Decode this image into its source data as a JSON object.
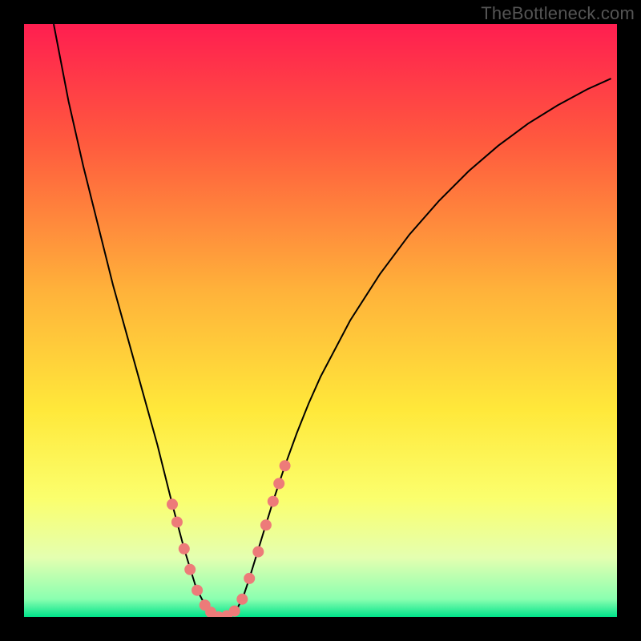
{
  "watermark": "TheBottleneck.com",
  "chart_data": {
    "type": "line",
    "title": "",
    "xlabel": "",
    "ylabel": "",
    "xlim": [
      0,
      1
    ],
    "ylim": [
      0,
      1
    ],
    "background_gradient": {
      "stops": [
        {
          "offset": 0.0,
          "color": "#ff1e50"
        },
        {
          "offset": 0.2,
          "color": "#ff5a3e"
        },
        {
          "offset": 0.45,
          "color": "#ffb23a"
        },
        {
          "offset": 0.65,
          "color": "#ffe83a"
        },
        {
          "offset": 0.8,
          "color": "#fbff6d"
        },
        {
          "offset": 0.9,
          "color": "#e4ffb0"
        },
        {
          "offset": 0.97,
          "color": "#8affb0"
        },
        {
          "offset": 1.0,
          "color": "#00e38a"
        }
      ]
    },
    "series": [
      {
        "name": "curve",
        "stroke": "#000000",
        "x": [
          0.05,
          0.075,
          0.1,
          0.125,
          0.15,
          0.175,
          0.2,
          0.225,
          0.25,
          0.27,
          0.29,
          0.3,
          0.31,
          0.32,
          0.33,
          0.34,
          0.35,
          0.36,
          0.37,
          0.38,
          0.4,
          0.42,
          0.44,
          0.46,
          0.48,
          0.5,
          0.55,
          0.6,
          0.65,
          0.7,
          0.75,
          0.8,
          0.85,
          0.9,
          0.95,
          0.99
        ],
        "y": [
          1.0,
          0.87,
          0.76,
          0.66,
          0.56,
          0.47,
          0.38,
          0.29,
          0.19,
          0.115,
          0.05,
          0.03,
          0.015,
          0.005,
          0.0,
          0.0,
          0.005,
          0.015,
          0.035,
          0.065,
          0.13,
          0.195,
          0.255,
          0.31,
          0.36,
          0.405,
          0.5,
          0.578,
          0.645,
          0.702,
          0.752,
          0.795,
          0.832,
          0.863,
          0.89,
          0.908
        ]
      }
    ],
    "markers": {
      "color": "#ed7b79",
      "radius_px": 7,
      "points": [
        {
          "x": 0.25,
          "y": 0.19
        },
        {
          "x": 0.258,
          "y": 0.16
        },
        {
          "x": 0.27,
          "y": 0.115
        },
        {
          "x": 0.28,
          "y": 0.08
        },
        {
          "x": 0.292,
          "y": 0.045
        },
        {
          "x": 0.305,
          "y": 0.02
        },
        {
          "x": 0.315,
          "y": 0.008
        },
        {
          "x": 0.328,
          "y": 0.0
        },
        {
          "x": 0.342,
          "y": 0.002
        },
        {
          "x": 0.355,
          "y": 0.01
        },
        {
          "x": 0.368,
          "y": 0.03
        },
        {
          "x": 0.38,
          "y": 0.065
        },
        {
          "x": 0.395,
          "y": 0.11
        },
        {
          "x": 0.408,
          "y": 0.155
        },
        {
          "x": 0.42,
          "y": 0.195
        },
        {
          "x": 0.43,
          "y": 0.225
        },
        {
          "x": 0.44,
          "y": 0.255
        }
      ]
    }
  }
}
